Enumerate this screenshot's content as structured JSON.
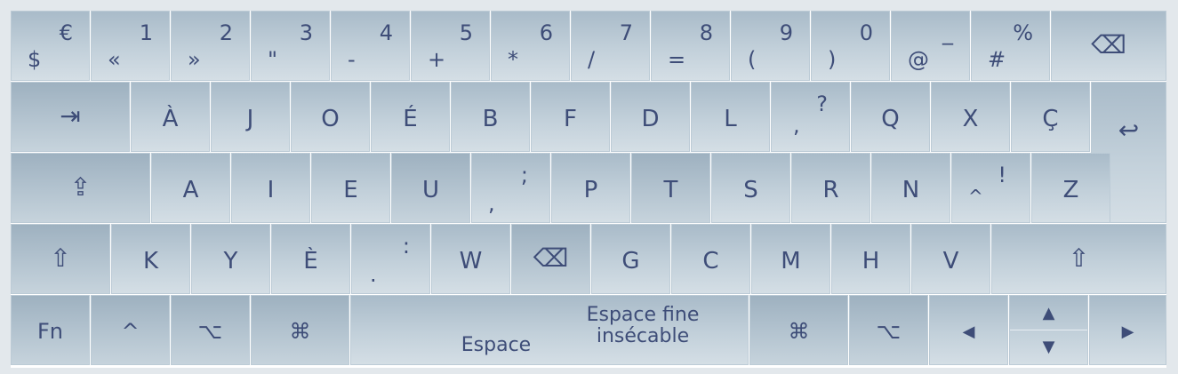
{
  "keyboard": {
    "row1": [
      {
        "top": "€",
        "bottom": "$"
      },
      {
        "top": "1",
        "bottom": "«"
      },
      {
        "top": "2",
        "bottom": "»"
      },
      {
        "top": "3",
        "bottom": "\""
      },
      {
        "top": "4",
        "bottom": "-"
      },
      {
        "top": "5",
        "bottom": "+"
      },
      {
        "top": "6",
        "bottom": "*"
      },
      {
        "top": "7",
        "bottom": "/"
      },
      {
        "top": "8",
        "bottom": "="
      },
      {
        "top": "9",
        "bottom": "("
      },
      {
        "top": "0",
        "bottom": ")"
      },
      {
        "top": "_",
        "bottom": "@"
      },
      {
        "top": "%",
        "bottom": "#"
      }
    ],
    "row2": [
      {
        "main": "À"
      },
      {
        "main": "J"
      },
      {
        "main": "O"
      },
      {
        "main": "É"
      },
      {
        "main": "B"
      },
      {
        "main": "F"
      },
      {
        "main": "D"
      },
      {
        "main": "L"
      },
      {
        "top": "?",
        "bottom": ","
      },
      {
        "main": "Q"
      },
      {
        "main": "X"
      },
      {
        "main": "Ç"
      }
    ],
    "row3": [
      {
        "main": "A"
      },
      {
        "main": "I"
      },
      {
        "main": "E"
      },
      {
        "main": "U"
      },
      {
        "top": ";",
        "bottom": ","
      },
      {
        "main": "P"
      },
      {
        "main": "T"
      },
      {
        "main": "S"
      },
      {
        "main": "R"
      },
      {
        "main": "N"
      },
      {
        "top": "!",
        "bottom": "^"
      },
      {
        "main": "Z"
      }
    ],
    "row4": [
      {
        "main": "K"
      },
      {
        "main": "Y"
      },
      {
        "main": "È"
      },
      {
        "top": ":",
        "bottom": "."
      },
      {
        "main": "W"
      },
      {
        "main": "G"
      },
      {
        "main": "C"
      },
      {
        "main": "M"
      },
      {
        "main": "H"
      },
      {
        "main": "V"
      }
    ],
    "row5": {
      "fn": "Fn",
      "ctrl": "^",
      "option_left": "⌥",
      "command_left": "⌘",
      "space": "Espace",
      "nbsp_line1": "Espace fine",
      "nbsp_line2": "insécable",
      "command_right": "⌘",
      "option_right": "⌥",
      "arrow_left": "◀",
      "arrow_up": "▲",
      "arrow_down": "▼",
      "arrow_right": "▶"
    },
    "icons": {
      "backspace": "⌫",
      "tab": "⇥",
      "enter": "↩",
      "capslock": "⇪",
      "shift": "⇧"
    }
  }
}
